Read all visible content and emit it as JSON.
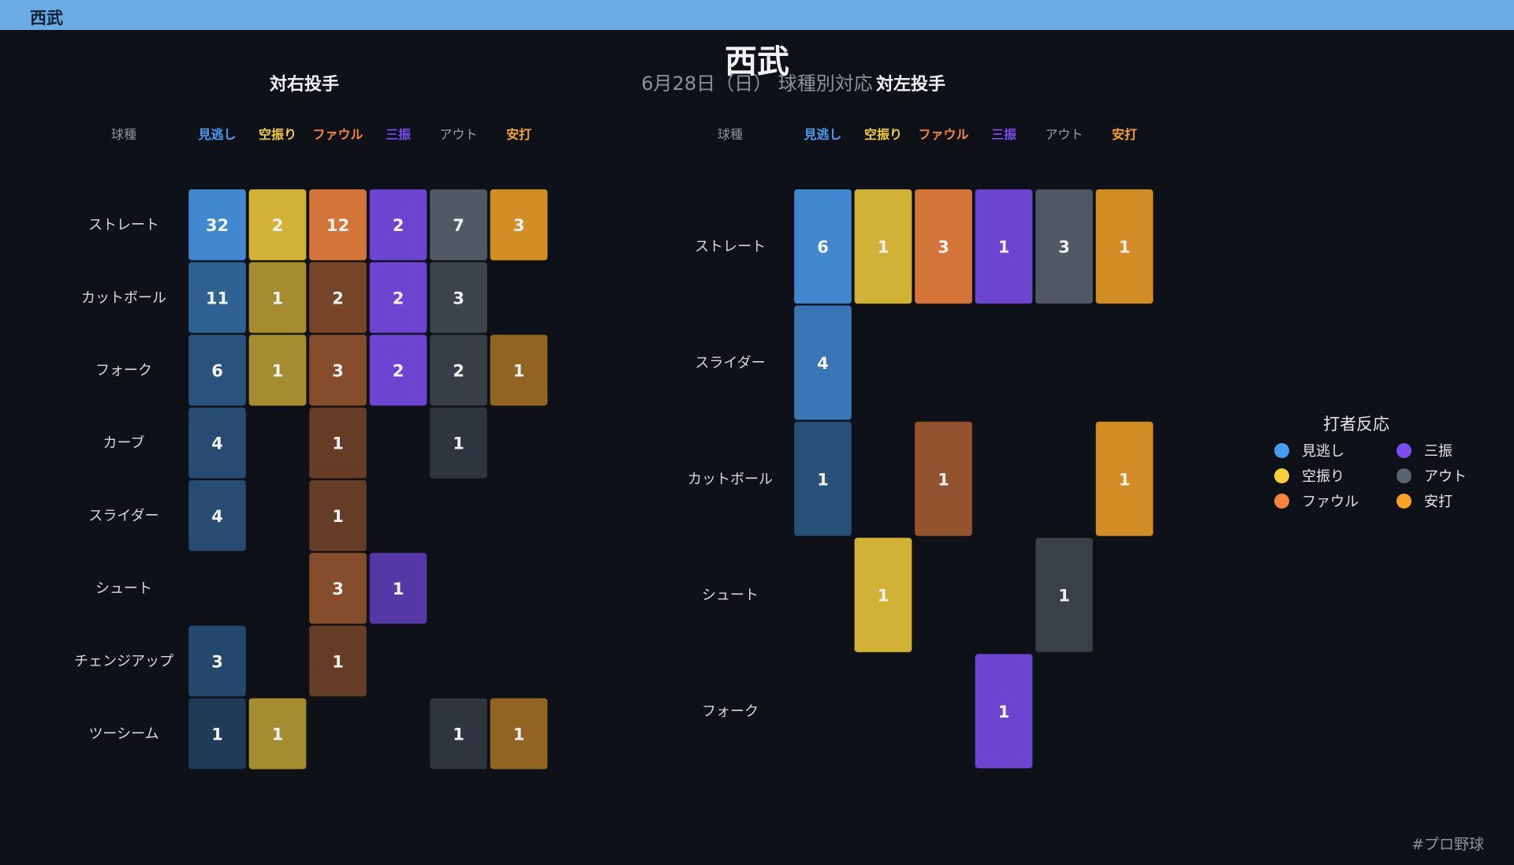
{
  "window": {
    "title": "西武"
  },
  "colors": {
    "background": "#0e1117",
    "titlebar": "#6aabe3",
    "見逃し": "#4a9cf0",
    "空振り": "#f5cd3d",
    "ファウル": "#f68540",
    "三振": "#7b4df0",
    "アウト": "#5a6470",
    "安打": "#f5a428"
  },
  "chart_data": {
    "type": "heatmap",
    "title": "西武",
    "subtitle": "6月28日（日） 球種別対応",
    "columns": [
      "見逃し",
      "空振り",
      "ファウル",
      "三振",
      "アウト",
      "安打"
    ],
    "legend": {
      "title": "打者反応",
      "placement": "right",
      "items": [
        "見逃し",
        "空振り",
        "ファウル",
        "三振",
        "アウト",
        "安打"
      ]
    },
    "footer": "#プロ野球",
    "panels": [
      {
        "title": "対右投手",
        "row_header": "球種",
        "rows": [
          "ストレート",
          "カットボール",
          "フォーク",
          "カーブ",
          "スライダー",
          "シュート",
          "チェンジアップ",
          "ツーシーム"
        ],
        "values": [
          [
            32,
            2,
            12,
            2,
            7,
            3
          ],
          [
            11,
            1,
            2,
            2,
            3,
            null
          ],
          [
            6,
            1,
            3,
            2,
            2,
            1
          ],
          [
            4,
            null,
            1,
            null,
            1,
            null
          ],
          [
            4,
            null,
            1,
            null,
            null,
            null
          ],
          [
            null,
            null,
            3,
            1,
            null,
            null
          ],
          [
            3,
            null,
            1,
            null,
            null,
            null
          ],
          [
            1,
            1,
            null,
            null,
            1,
            1
          ]
        ]
      },
      {
        "title": "対左投手",
        "row_header": "球種",
        "rows": [
          "ストレート",
          "スライダー",
          "カットボール",
          "シュート",
          "フォーク"
        ],
        "values": [
          [
            6,
            1,
            3,
            1,
            3,
            1
          ],
          [
            4,
            null,
            null,
            null,
            null,
            null
          ],
          [
            1,
            null,
            1,
            null,
            null,
            1
          ],
          [
            null,
            1,
            null,
            null,
            1,
            null
          ],
          [
            null,
            null,
            null,
            1,
            null,
            null
          ]
        ]
      }
    ]
  }
}
